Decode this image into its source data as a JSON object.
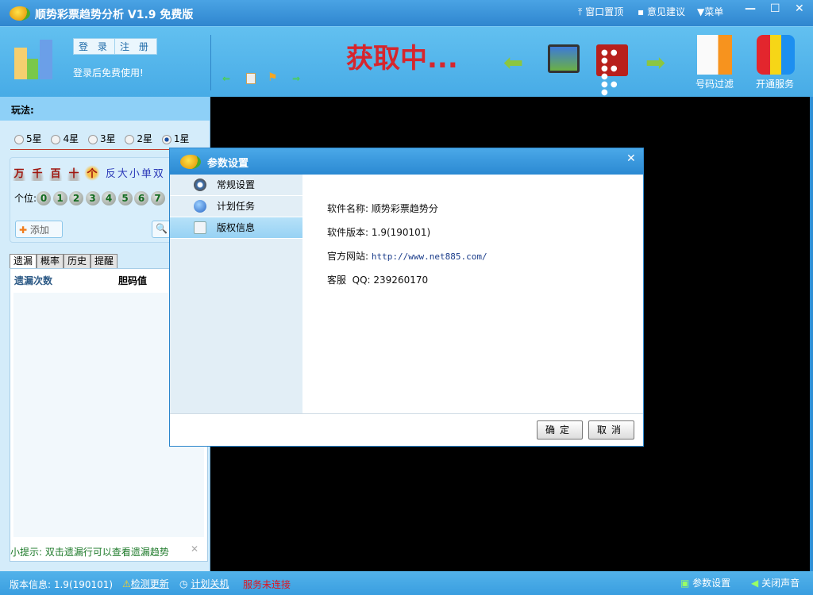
{
  "titlebar": {
    "title": "顺势彩票趋势分析 V1.9 免费版",
    "pin": "窗口置顶",
    "feedback": "意见建议",
    "menu": "菜单"
  },
  "toolbar": {
    "login": "登 录",
    "register": "注 册",
    "login_hint": "登录后免费使用!",
    "loading": "获取中...",
    "filter": "号码过滤",
    "service": "开通服务"
  },
  "left": {
    "play_label": "玩法:",
    "stars": [
      {
        "label": "5星",
        "selected": false
      },
      {
        "label": "4星",
        "selected": false
      },
      {
        "label": "3星",
        "selected": false
      },
      {
        "label": "2星",
        "selected": false
      },
      {
        "label": "1星",
        "selected": true
      }
    ],
    "positions": [
      "万",
      "千",
      "百",
      "十",
      "个"
    ],
    "filters": "反大小单双",
    "digit_label": "个位:",
    "digits": [
      "0",
      "1",
      "2",
      "3",
      "4",
      "5",
      "6",
      "7"
    ],
    "add": "添加",
    "tabs": [
      "遗漏",
      "概率",
      "历史",
      "提醒"
    ],
    "col1": "遗漏次数",
    "col2": "胆码值",
    "tip": "小提示: 双击遗漏行可以查看遗漏趋势"
  },
  "dialog": {
    "title": "参数设置",
    "nav": [
      "常规设置",
      "计划任务",
      "版权信息"
    ],
    "active_nav": 2,
    "name_label": "软件名称:",
    "name_value": "顺势彩票趋势分",
    "version_label": "软件版本:",
    "version_value": "1.9(190101)",
    "site_label": "官方网站:",
    "site_value": "http://www.net885.com/",
    "qq_label": "客服  QQ:",
    "qq_value": "239260170",
    "ok": "确定",
    "cancel": "取消"
  },
  "status": {
    "version": "版本信息: 1.9(190101)",
    "check_update": "检测更新",
    "schedule_shutdown": "计划关机",
    "service_state": "服务未连接",
    "settings": "参数设置",
    "mute": "关闭声音"
  },
  "colors": {
    "accent": "#2f86cf",
    "error": "#e0141e"
  }
}
